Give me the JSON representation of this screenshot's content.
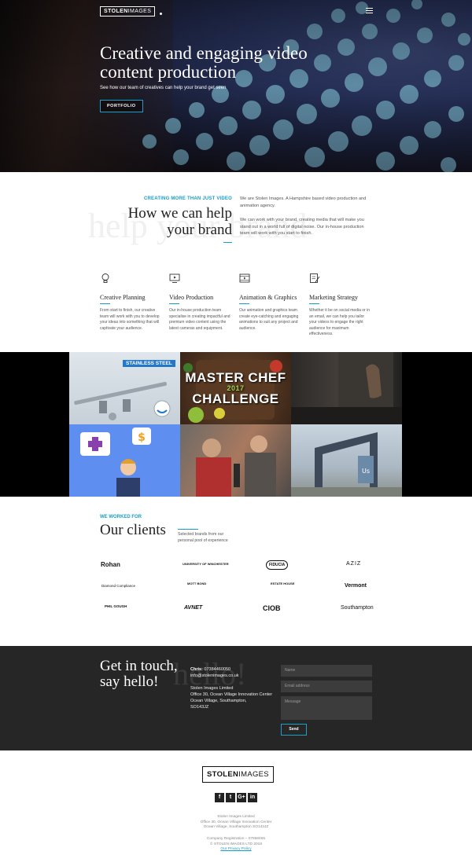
{
  "header": {
    "logo_bold": "STOLEN",
    "logo_light": "IMAGES",
    "menu_icon": "hamburger-icon"
  },
  "hero": {
    "title": "Creative and engaging video content production",
    "subtitle": "See how our team of creatives can help your brand get seen",
    "button": "PORTFOLIO"
  },
  "help": {
    "kicker": "CREATING MORE THAN JUST VIDEO",
    "title_line1": "How we can help",
    "title_line2": "your brand",
    "ghost": "help your brand",
    "p1": "We are Stolen Images. A Hampshire based video production and animation agency.",
    "p2": "We can work with your brand, creating media that will make you stand out in a world full of digital noise. Our in-house production team will work with you start to finish.",
    "services": [
      {
        "icon": "lightbulb-icon",
        "title": "Creative Planning",
        "text": "From start to finish, our creative team will work with you to develop your ideas into something that will captivate your audience."
      },
      {
        "icon": "video-monitor-icon",
        "title": "Video Production",
        "text": "Our in-house production team specialise in creating impactful and premium video content using the latest cameras and equipment."
      },
      {
        "icon": "film-strip-icon",
        "title": "Animation & Graphics",
        "text": "Our animation and graphics team create eye-catching and engaging animations to suit any project and audience."
      },
      {
        "icon": "clipboard-pen-icon",
        "title": "Marketing Strategy",
        "text": "Whether it be on social media or in an email, we can help you tailor your videos to engage the right audience for maximum effectiveness."
      }
    ]
  },
  "gallery": {
    "stainless_label": "STAINLESS STEEL",
    "masterchef_line1": "MASTER CHEF",
    "masterchef_year": "2017",
    "masterchef_line2": "CHALLENGE"
  },
  "clients": {
    "kicker": "WE WORKED FOR",
    "title": "Our clients",
    "subtitle": "Selected brands from our personal pool of experience",
    "brands": [
      "Rohan",
      "UNIVERSITY OF WINCHESTER",
      "FIDUCIA",
      "AZIZ",
      "Diamond Compliance",
      "MOTT BOND",
      "ESTATE HOUSE",
      "Vermont",
      "PHIL GOUGH",
      "AVNET",
      "CIOB",
      "Southampton"
    ]
  },
  "contact": {
    "title_line1": "Get in touch,",
    "title_line2": "say hello!",
    "ghost": "hello!",
    "name_label": "Chris:",
    "phone": "07384460050",
    "email": "info@stolenimages.co.uk",
    "address": [
      "Stolen Images Limited",
      "Office 30, Ocean Village Innovation Center",
      "Ocean Village, Southampton,",
      "SO143JZ"
    ],
    "placeholder_name": "Name",
    "placeholder_email": "Email address",
    "placeholder_message": "Message",
    "send": "Send"
  },
  "footer": {
    "logo_bold": "STOLEN",
    "logo_light": "IMAGES",
    "socials": [
      "f",
      "t",
      "G+",
      "in"
    ],
    "address": [
      "Stolen Images Limited",
      "Office 30, Ocean Village Innovation Center",
      "Ocean Village, Southampton SO143JZ"
    ],
    "company_reg": "Company Registration – 07858465",
    "copyright": "© STOLEN IMAGES LTD 2018",
    "privacy": "Our Privacy Policy"
  },
  "colors": {
    "accent": "#1a9cc8",
    "dark": "#262626"
  }
}
